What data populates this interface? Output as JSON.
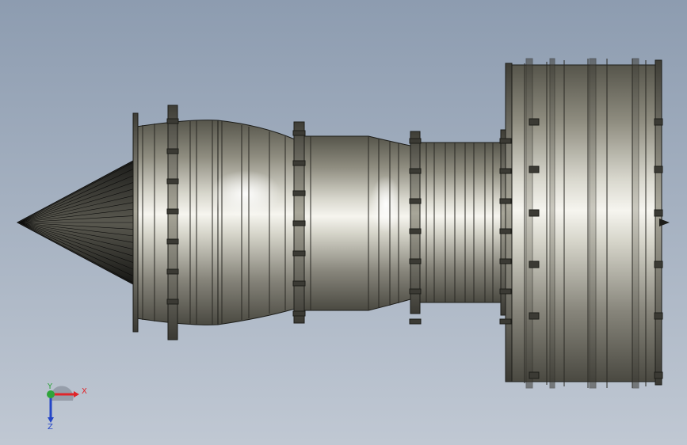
{
  "viewport": {
    "background_top": "#8d9cb0",
    "background_bottom": "#c0c8d3"
  },
  "model": {
    "metal_dark": "#4c4b42",
    "metal_mid": "#a7a597",
    "metal_light": "#f2f1ea",
    "outline": "#1d1d19"
  },
  "triad": {
    "x_label": "X",
    "y_label": "Y",
    "z_label": "Z",
    "x_color": "#e0252a",
    "y_color": "#2ea43a",
    "z_color": "#2445c7"
  }
}
